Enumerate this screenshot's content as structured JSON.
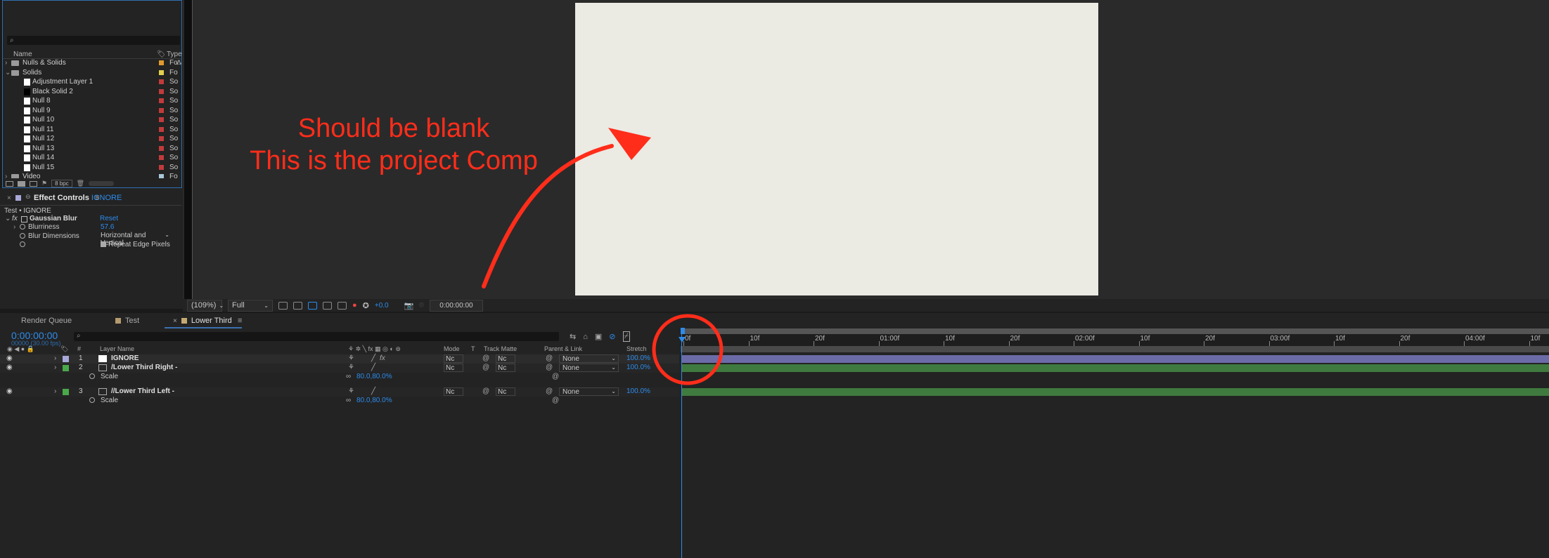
{
  "project": {
    "search_placeholder": "⌕",
    "col_name": "Name",
    "col_type": "Type",
    "items": [
      {
        "name": "Nulls & Solids",
        "type": "Fo",
        "color": "#e09a2e",
        "kind": "folder",
        "twirl": "›",
        "indent": 0
      },
      {
        "name": "Solids",
        "type": "Fo",
        "color": "#e3cf4f",
        "kind": "folder",
        "twirl": "⌄",
        "indent": 0
      },
      {
        "name": "Adjustment Layer 1",
        "type": "So",
        "color": "#c23b3b",
        "kind": "white",
        "indent": 1
      },
      {
        "name": "Black Solid 2",
        "type": "So",
        "color": "#c23b3b",
        "kind": "black",
        "indent": 1
      },
      {
        "name": "Null 8",
        "type": "So",
        "color": "#c23b3b",
        "kind": "white",
        "indent": 1
      },
      {
        "name": "Null 9",
        "type": "So",
        "color": "#c23b3b",
        "kind": "white",
        "indent": 1
      },
      {
        "name": "Null 10",
        "type": "So",
        "color": "#c23b3b",
        "kind": "white",
        "indent": 1
      },
      {
        "name": "Null 11",
        "type": "So",
        "color": "#c23b3b",
        "kind": "white",
        "indent": 1
      },
      {
        "name": "Null 12",
        "type": "So",
        "color": "#c23b3b",
        "kind": "white",
        "indent": 1
      },
      {
        "name": "Null 13",
        "type": "So",
        "color": "#c23b3b",
        "kind": "white",
        "indent": 1
      },
      {
        "name": "Null 14",
        "type": "So",
        "color": "#c23b3b",
        "kind": "white",
        "indent": 1
      },
      {
        "name": "Null 15",
        "type": "So",
        "color": "#c23b3b",
        "kind": "white",
        "indent": 1
      },
      {
        "name": "Video",
        "type": "Fo",
        "color": "#a9c7d6",
        "kind": "folder",
        "twirl": "›",
        "indent": 0
      }
    ],
    "bpc": "8 bpc"
  },
  "effects": {
    "title": "Effect Controls",
    "target": "IGNORE",
    "path": "Test • IGNORE",
    "effect_name": "Gaussian Blur",
    "reset": "Reset",
    "props": [
      {
        "name": "Blurriness",
        "value": "57.6"
      },
      {
        "name": "Blur Dimensions",
        "value": "Horizontal and Vertical"
      },
      {
        "name": "",
        "value": "Repeat Edge Pixels"
      }
    ]
  },
  "viewer": {
    "zoom": "(109%)",
    "resolution": "Full",
    "exposure": "+0.0",
    "timecode": "0:00:00:00",
    "annotation_line1": "Should be blank",
    "annotation_line2": "This is the project Comp",
    "canvas_color": "#ebeae3",
    "annotation_color": "#ff2d1a"
  },
  "timeline": {
    "tabs": [
      "Render Queue",
      "Test",
      "Lower Third"
    ],
    "tab_colors": [
      "#232323",
      "#b59a6d",
      "#c4a972"
    ],
    "active_tab": "Lower Third",
    "current_time": "0:00:00:00",
    "frame_info": "00000 (30.00 fps)",
    "columns": {
      "num": "#",
      "layer_name": "Layer Name",
      "mode": "Mode",
      "t": "T",
      "track_matte": "Track Matte",
      "parent": "Parent & Link",
      "stretch": "Stretch"
    },
    "ruler": [
      "0f",
      "10f",
      "20f",
      "01:00f",
      "10f",
      "20f",
      "02:00f",
      "10f",
      "20f",
      "03:00f",
      "10f",
      "20f",
      "04:00f",
      "10f"
    ],
    "layers": [
      {
        "num": "1",
        "name": "IGNORE",
        "label_color": "#a7a7d8",
        "mode": "Nc",
        "matte": "Nc",
        "parent": "None",
        "stretch": "100.0%",
        "bar_color": "#6b6ba8"
      },
      {
        "num": "2",
        "name": "/Lower Third Right -",
        "label_color": "#4aa84a",
        "mode": "Nc",
        "matte": "Nc",
        "parent": "None",
        "stretch": "100.0%",
        "bar_color": "#3f7a3f"
      },
      {
        "num": "3",
        "name": "//Lower Third Left -",
        "label_color": "#4aa84a",
        "mode": "Nc",
        "matte": "Nc",
        "parent": "None",
        "stretch": "100.0%",
        "bar_color": "#3f7a3f"
      }
    ],
    "scale_label": "Scale",
    "scale_value": "80.0,80.0%"
  }
}
